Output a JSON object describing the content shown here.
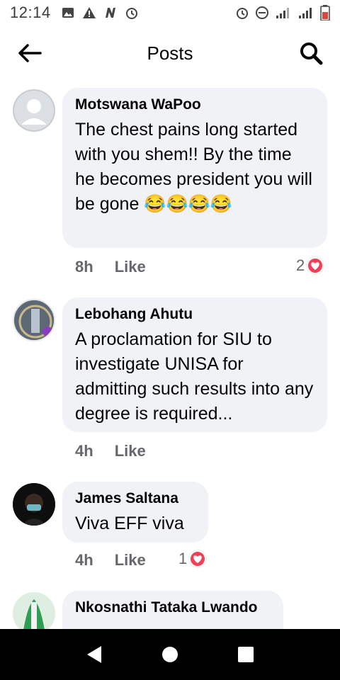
{
  "status_bar": {
    "time": "12:14",
    "left_icons": [
      "image-icon",
      "warning-icon",
      "n-icon",
      "alarm-icon"
    ],
    "right_icons": [
      "alarm-icon",
      "dnd-icon",
      "signal-icon",
      "signal-icon",
      "battery-icon"
    ]
  },
  "header": {
    "title": "Posts"
  },
  "comments": [
    {
      "author": "Motswana WaPoo",
      "text": "The chest pains long started with you shem!! By the time he becomes president you will be gone 😂😂😂😂",
      "time": "8h",
      "like_label": "Like",
      "reaction_count": "2"
    },
    {
      "author": "Lebohang Ahutu",
      "text": "A proclamation for SIU to investigate UNISA for admitting such results into any degree is required...",
      "time": "4h",
      "like_label": "Like",
      "reaction_count": ""
    },
    {
      "author": "James Saltana",
      "text": "Viva EFF viva",
      "time": "4h",
      "like_label": "Like",
      "reaction_count": "1"
    },
    {
      "author": "Nkosnathi Tataka Lwando",
      "text": "",
      "time": "",
      "like_label": "",
      "reaction_count": ""
    }
  ],
  "colors": {
    "bubble": "#f0f2f5",
    "meta": "#65676b",
    "heart": "#f33e58"
  }
}
